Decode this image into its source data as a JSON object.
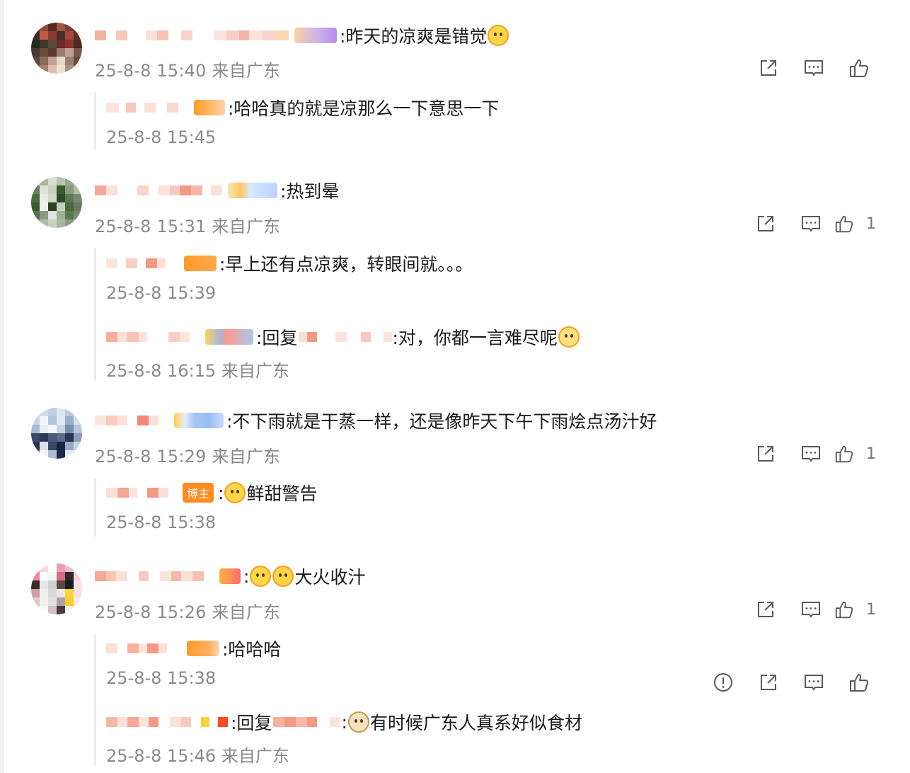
{
  "comments": [
    {
      "text": ":昨天的凉爽是错觉",
      "emoji": "melting-face-emoji",
      "meta": "25-8-8 15:40 来自广东",
      "likes": "",
      "replies": [
        {
          "text": ":哈哈真的就是凉那么一下意思一下",
          "meta": "25-8-8 15:45"
        }
      ]
    },
    {
      "text": ":热到晕",
      "meta": "25-8-8 15:31 来自广东",
      "likes": "1",
      "replies": [
        {
          "text": ":早上还有点凉爽，转眼间就。。。",
          "meta": "25-8-8 15:39"
        },
        {
          "prefix": ":回复",
          "text": ":对，你都一言难尽呢",
          "emoji": "thinking-face-emoji",
          "meta": "25-8-8 16:15 来自广东"
        }
      ]
    },
    {
      "text": ":不下雨就是干蒸一样，还是像昨天下午下雨烩点汤汁好",
      "meta": "25-8-8 15:29 来自广东",
      "likes": "1",
      "replies": [
        {
          "badge": "博主",
          "text": "鲜甜警告",
          "emoji": "yummy-face-emoji",
          "meta": "25-8-8 15:38"
        }
      ]
    },
    {
      "text": "大火收汁",
      "emoji": "laughing-crying-emoji",
      "meta": "25-8-8 15:26 来自广东",
      "likes": "1",
      "replies": [
        {
          "text": ":哈哈哈",
          "meta": "25-8-8 15:38"
        },
        {
          "prefix": ":回复",
          "text": "有时候广东人真系好似食材",
          "emoji": "doge-emoji",
          "meta": "25-8-8 15:46 来自广东"
        }
      ]
    }
  ],
  "icons": {
    "share": "share-icon",
    "comment": "comment-icon",
    "like": "like-icon",
    "report": "report-icon"
  },
  "colors": {
    "meta_text": "#8a8a8a",
    "icon_stroke": "#5a5a5a",
    "badge_orange": "#ff8a1f",
    "reply_border": "#ebebeb"
  }
}
